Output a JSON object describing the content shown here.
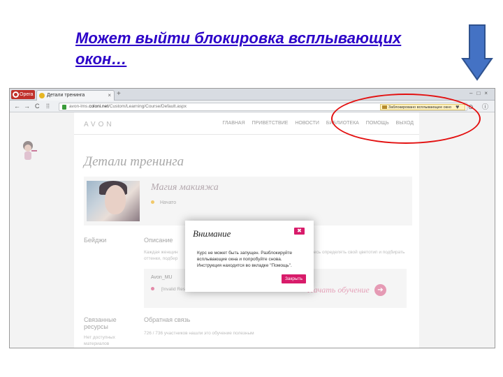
{
  "slide": {
    "title": "Может выйти блокировка всплывающих окон…"
  },
  "browser": {
    "opera_label": "Opera",
    "tab_title": "Детали тренинга",
    "tab_close": "×",
    "new_tab": "+",
    "window_controls": "–□×",
    "back": "←",
    "forward": "→",
    "reload": "C",
    "grid": "⁞⁞",
    "url_prefix": "avon-lms.",
    "url_host": "coloni.net",
    "url_path": "/Custom/Learning/Course/Default.aspx",
    "popup_blocked": "Заблокировано всплывающее окно",
    "toolbar_icons": "♥ ⊙ ⓘ"
  },
  "page": {
    "logo": "AVON",
    "nav": [
      "ГЛАВНАЯ",
      "ПРИВЕТСТВИЕ",
      "НОВОСТИ",
      "БИБЛИОТЕКА",
      "ПОМОЩЬ",
      "ВЫХОД"
    ],
    "heading": "Детали тренинга",
    "course_title": "Магия макияжа",
    "course_status": "Начато",
    "badges_label": "Бейджи",
    "description_label": "Описание",
    "description_text_left": "Каждая женщин",
    "description_text_left2": "оттенки, подбер",
    "description_text_right": "тесь определять свой цветотип и подбирать",
    "module_title": "Avon_MU",
    "module_status": "[Invalid Resource: notattempted]",
    "start_link": "Начать обучение",
    "related_label": "Связанные ресурсы",
    "related_text": "Нет доступных материалов",
    "feedback_label": "Обратная связь",
    "feedback_text": "726 / 736 участников нашли это обучение полезным"
  },
  "modal": {
    "title": "Внимание",
    "close_icon": "✖",
    "text": "Курс не может быть запущен. Разблокируйте всплывающие окна и попробуйте снова. Инструкция находится во вкладке \"Помощь\".",
    "button": "Закрыть"
  },
  "colors": {
    "title_blue": "#2b00c8",
    "arrow_blue": "#4472c4",
    "annotation_red": "#e31010",
    "avon_pink": "#d81b6a"
  }
}
